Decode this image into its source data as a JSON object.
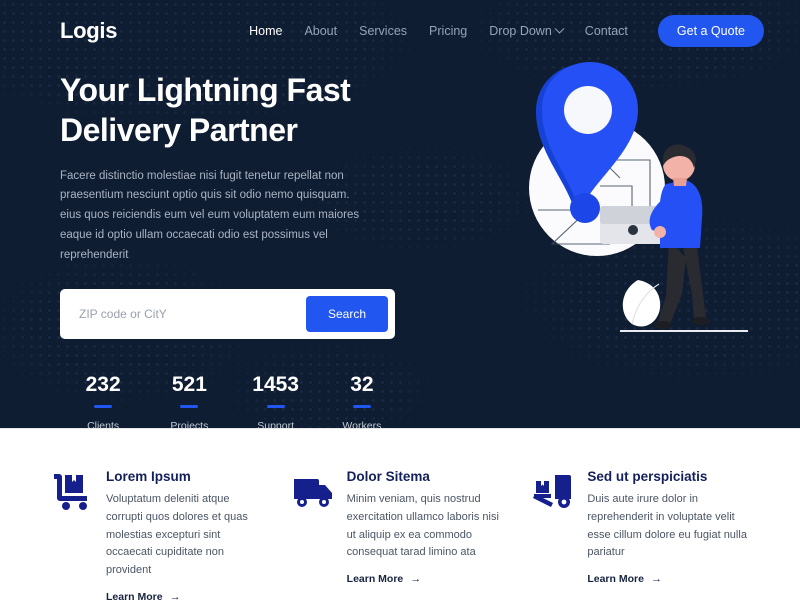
{
  "colors": {
    "hero_bg": "#0f1d32",
    "accent_blue": "#2156f0",
    "icon_navy": "#16208c",
    "title_navy": "#14205c",
    "section_bg": "#ffffff"
  },
  "header": {
    "logo": "Logis",
    "nav": [
      {
        "label": "Home",
        "active": true,
        "icon": null
      },
      {
        "label": "About",
        "active": false,
        "icon": null
      },
      {
        "label": "Services",
        "active": false,
        "icon": null
      },
      {
        "label": "Pricing",
        "active": false,
        "icon": null
      },
      {
        "label": "Drop Down",
        "active": false,
        "icon": "chevron-down-icon"
      },
      {
        "label": "Contact",
        "active": false,
        "icon": null
      }
    ],
    "cta_label": "Get a Quote"
  },
  "hero": {
    "title_line1": "Your Lightning Fast",
    "title_line2": "Delivery Partner",
    "description": "Facere distinctio molestiae nisi fugit tenetur repellat non praesentium nesciunt optio quis sit odio nemo quisquam. eius quos reiciendis eum vel eum voluptatem eum maiores eaque id optio ullam occaecati odio est possimus vel reprehenderit",
    "search": {
      "placeholder": "ZIP code or CitY",
      "value": "",
      "button_label": "Search"
    },
    "stats": [
      {
        "number": "232",
        "label": "Clients"
      },
      {
        "number": "521",
        "label": "Projects"
      },
      {
        "number": "1453",
        "label": "Support"
      },
      {
        "number": "32",
        "label": "Workers"
      }
    ],
    "illustration_name": "delivery-location-illustration"
  },
  "features": {
    "learn_more_label": "Learn More",
    "learn_more_arrow": "→",
    "cards": [
      {
        "icon": "hand-truck-box-icon",
        "title": "Lorem Ipsum",
        "text": "Voluptatum deleniti atque corrupti quos dolores et quas molestias excepturi sint occaecati cupiditate non provident"
      },
      {
        "icon": "delivery-truck-icon",
        "title": "Dolor Sitema",
        "text": "Minim veniam, quis nostrud exercitation ullamco laboris nisi ut aliquip ex ea commodo consequat tarad limino ata"
      },
      {
        "icon": "forklift-pallet-icon",
        "title": "Sed ut perspiciatis",
        "text": "Duis aute irure dolor in reprehenderit in voluptate velit esse cillum dolore eu fugiat nulla pariatur"
      }
    ]
  }
}
